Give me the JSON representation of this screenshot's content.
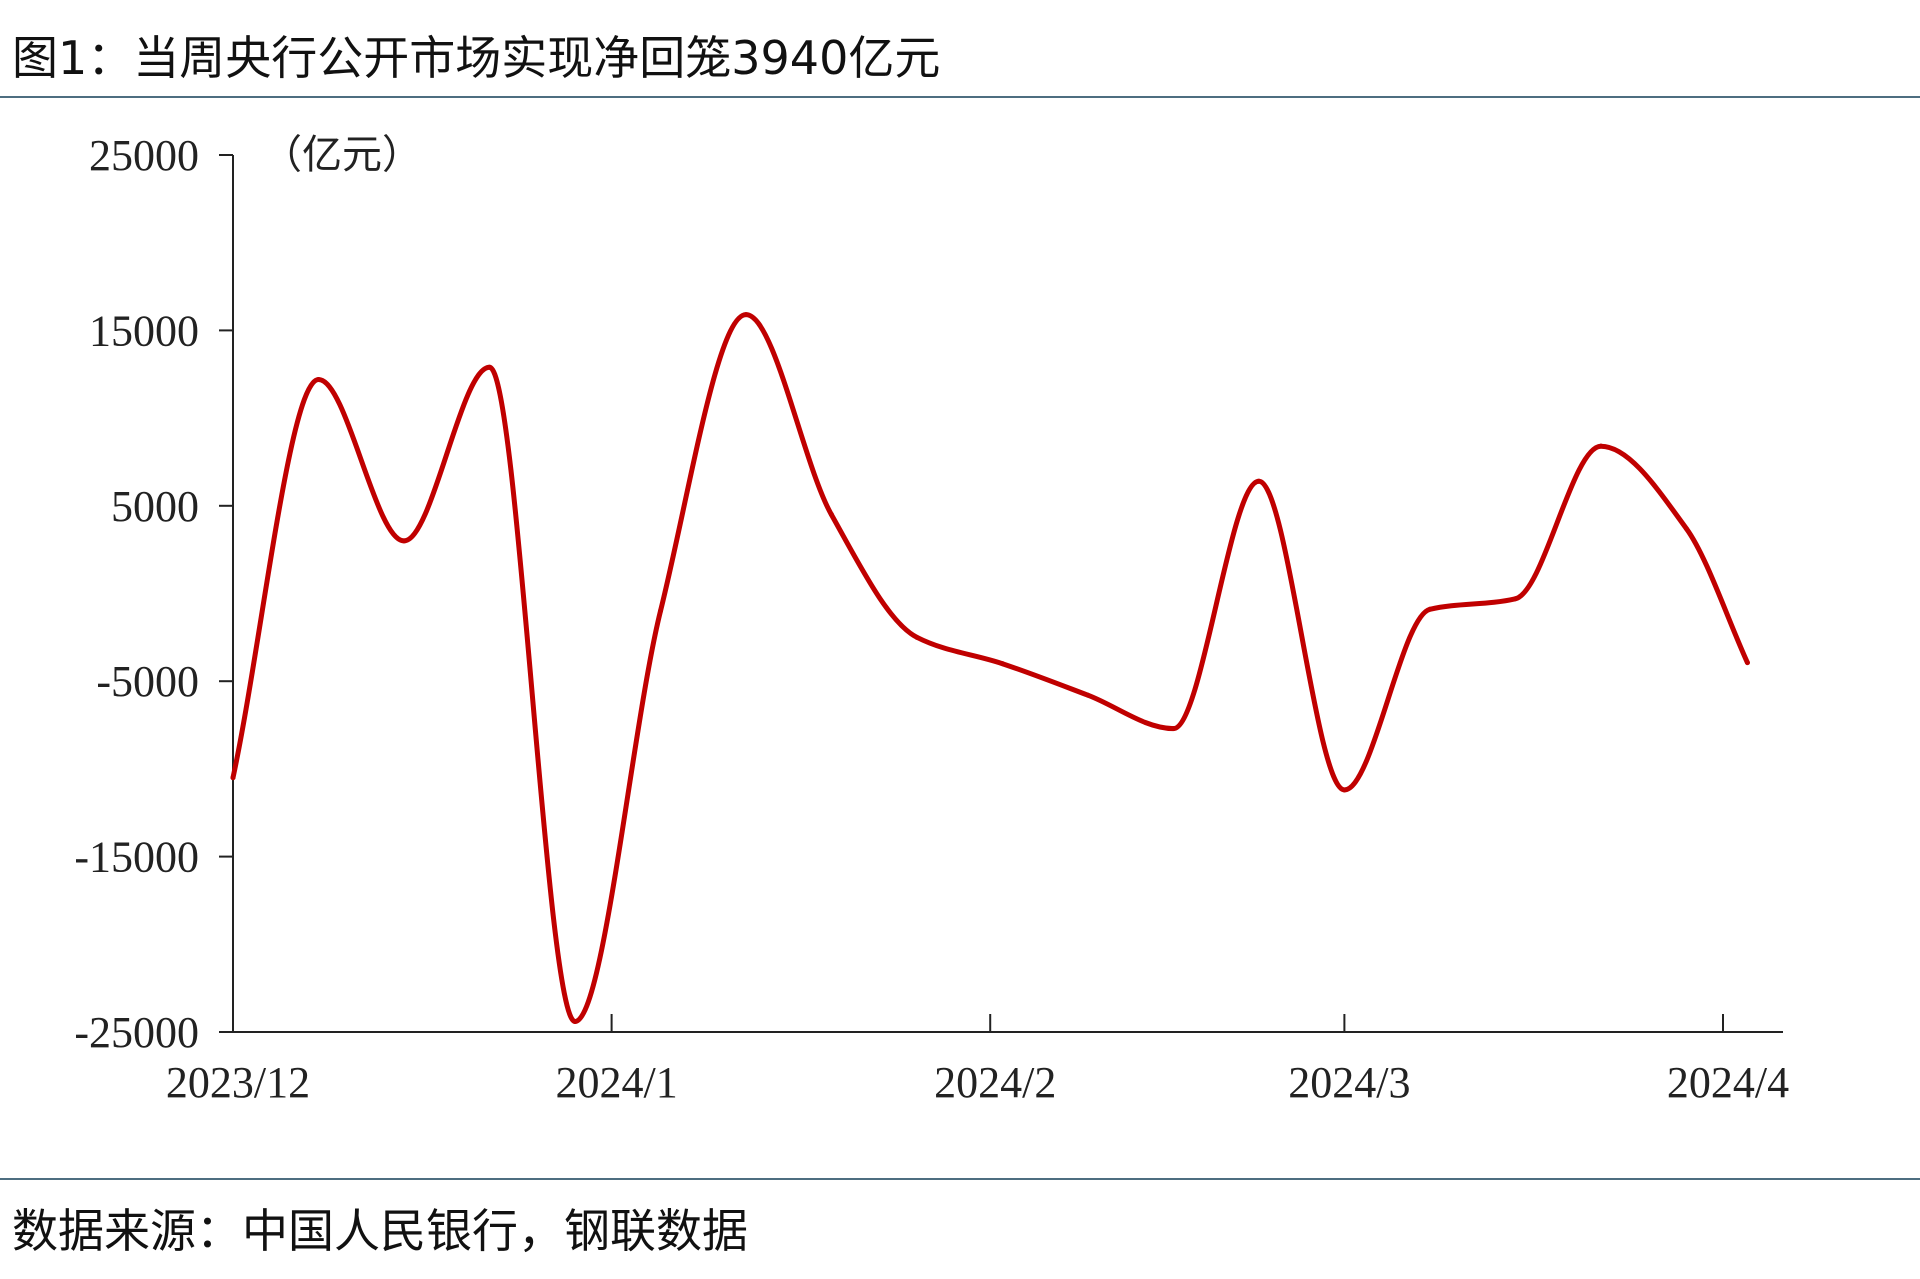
{
  "title": "图1：当周央行公开市场实现净回笼3940亿元",
  "source": "数据来源：中国人民银行，钢联数据",
  "colors": {
    "line": "#c00000",
    "axis": "#222222",
    "rule": "#4d6e80"
  },
  "chart_data": {
    "type": "line",
    "title": "图1：当周央行公开市场实现净回笼3940亿元",
    "ylabel": "（亿元）",
    "xlabel": "",
    "ylim": [
      -25000,
      25000
    ],
    "yticks": [
      25000,
      15000,
      5000,
      -5000,
      -15000,
      -25000
    ],
    "x_tick_labels": [
      "2023/12",
      "2024/1",
      "2024/2",
      "2024/3",
      "2024/4"
    ],
    "grid": false,
    "legend": "none",
    "x": [
      "2023/12/01",
      "2023/12/08",
      "2023/12/15",
      "2023/12/22",
      "2023/12/29",
      "2024/01/05",
      "2024/01/12",
      "2024/01/19",
      "2024/01/26",
      "2024/02/02",
      "2024/02/09",
      "2024/02/16",
      "2024/02/23",
      "2024/03/01",
      "2024/03/08",
      "2024/03/15",
      "2024/03/22",
      "2024/03/29",
      "2024/04/03"
    ],
    "series": [
      {
        "values": [
          -10500,
          12200,
          3000,
          12900,
          -24400,
          -1000,
          15900,
          4500,
          -2500,
          -4000,
          -5800,
          -7700,
          6400,
          -11200,
          -900,
          -300,
          8400,
          3700,
          -3940
        ]
      }
    ]
  }
}
